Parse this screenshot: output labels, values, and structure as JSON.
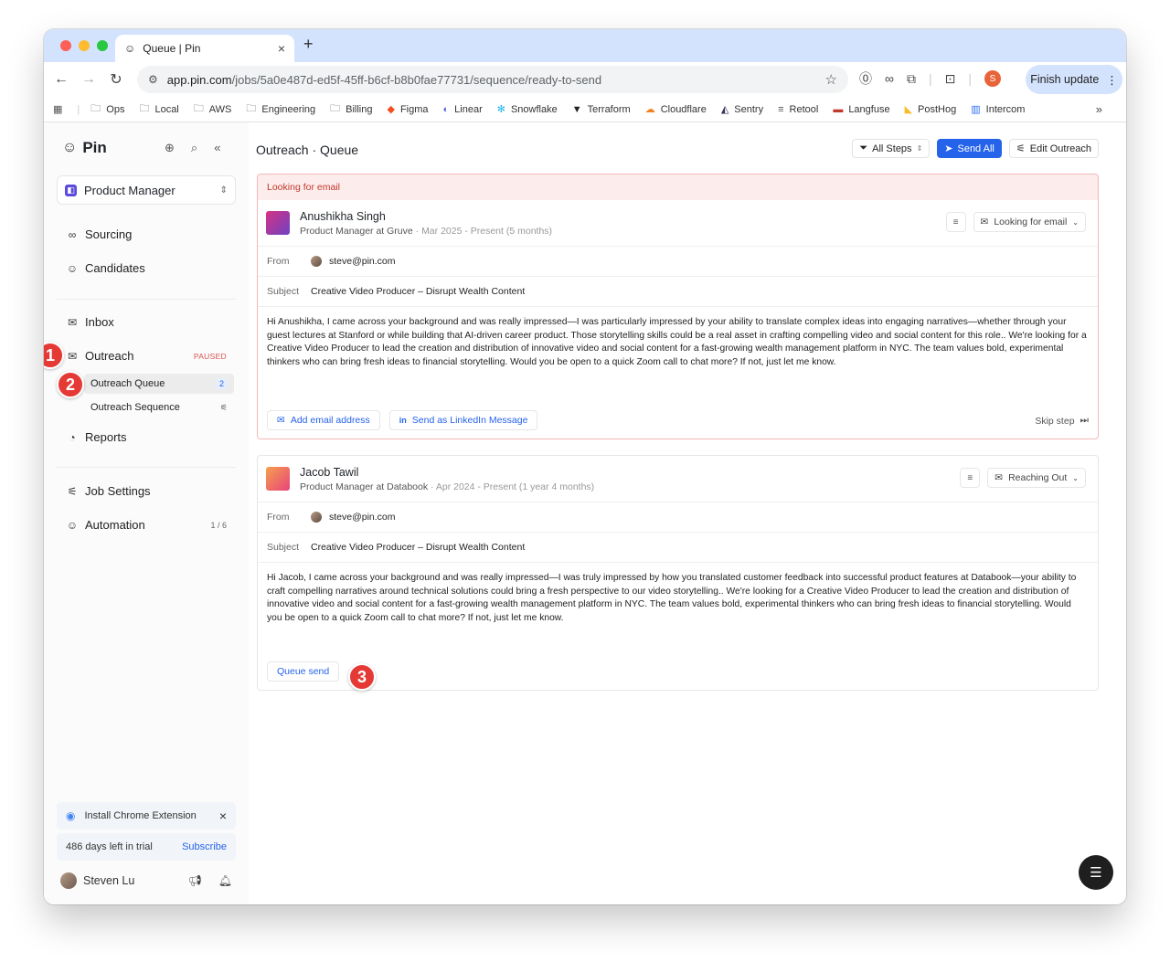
{
  "browser": {
    "tab_title": "Queue | Pin",
    "url_host": "app.pin.com",
    "url_path": "/jobs/5a0e487d-ed5f-45ff-b6cf-b8b0fae77731/sequence/ready-to-send",
    "profile_initial": "S",
    "finish_update": "Finish update",
    "bookmarks": [
      "Ops",
      "Local",
      "AWS",
      "Engineering",
      "Billing",
      "Figma",
      "Linear",
      "Snowflake",
      "Terraform",
      "Cloudflare",
      "Sentry",
      "Retool",
      "Langfuse",
      "PostHog",
      "Intercom"
    ]
  },
  "sidebar": {
    "brand": "Pin",
    "workspace": "Product Manager",
    "sourcing": "Sourcing",
    "candidates": "Candidates",
    "inbox": "Inbox",
    "outreach": "Outreach",
    "outreach_status": "PAUSED",
    "outreach_queue": "Outreach Queue",
    "outreach_queue_count": "2",
    "outreach_sequence": "Outreach Sequence",
    "reports": "Reports",
    "job_settings": "Job Settings",
    "automation": "Automation",
    "automation_count": "1 / 6",
    "install_extension": "Install Chrome Extension",
    "trial_text": "486 days left in trial",
    "subscribe": "Subscribe",
    "user_name": "Steven Lu"
  },
  "main": {
    "title_section": "Outreach",
    "title_separator": " · ",
    "title_page": "Queue",
    "filter_label": "All Steps",
    "send_all": "Send All",
    "edit_outreach": "Edit Outreach"
  },
  "cards": [
    {
      "banner": "Looking for email",
      "name": "Anushikha Singh",
      "role": "Product Manager at Gruve",
      "dates": " · Mar 2025 - Present (5 months)",
      "status": "Looking for email",
      "from_label": "From",
      "from": "steve@pin.com",
      "subject_label": "Subject",
      "subject": "Creative Video Producer – Disrupt Wealth Content",
      "body": "Hi Anushikha, I came across your background and was really impressed—I was particularly impressed by your ability to translate complex ideas into engaging narratives—whether through your guest lectures at Stanford or while building that AI-driven career product. Those storytelling skills could be a real asset in crafting compelling video and social content for this role.. We're looking for a Creative Video Producer to lead the creation and distribution of innovative video and social content for a fast-growing wealth management platform in NYC. The team values bold, experimental thinkers who can bring fresh ideas to financial storytelling. Would you be open to a quick Zoom call to chat more? If not, just let me know.",
      "action_1": "Add email address",
      "action_2": "Send as LinkedIn Message",
      "skip": "Skip step"
    },
    {
      "name": "Jacob Tawil",
      "role": "Product Manager at Databook",
      "dates": " · Apr 2024 - Present (1 year 4 months)",
      "status": "Reaching Out",
      "from_label": "From",
      "from": "steve@pin.com",
      "subject_label": "Subject",
      "subject": "Creative Video Producer – Disrupt Wealth Content",
      "body": "Hi Jacob, I came across your background and was really impressed—I was truly impressed by how you translated customer feedback into successful product features at Databook—your ability to craft compelling narratives around technical solutions could bring a fresh perspective to our video storytelling.. We're looking for a Creative Video Producer to lead the creation and distribution of innovative video and social content for a fast-growing wealth management platform in NYC. The team values bold, experimental thinkers who can bring fresh ideas to financial storytelling. Would you be open to a quick Zoom call to chat more? If not, just let me know.",
      "action_1": "Queue send"
    }
  ],
  "markers": [
    "1",
    "2",
    "3"
  ],
  "colors": {
    "accent": "#2563eb",
    "alert": "#c0392b",
    "marker": "#e53935"
  }
}
